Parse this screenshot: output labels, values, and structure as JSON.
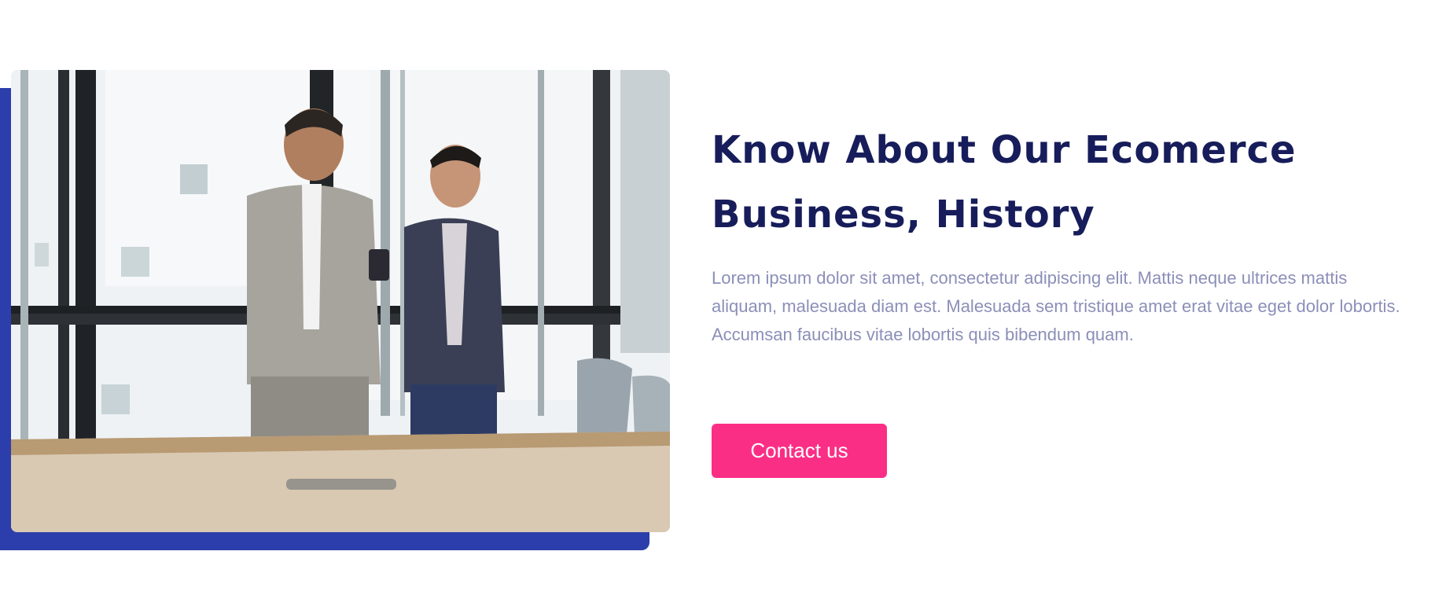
{
  "about": {
    "title": "Know About Our Ecomerce Business, History",
    "description": "Lorem ipsum dolor sit amet, consectetur adipiscing elit. Mattis neque ultrices mattis aliquam, malesuada diam est. Malesuada sem tristique amet erat vitae eget dolor lobortis. Accumsan faucibus vitae lobortis quis bibendum quam.",
    "cta_label": "Contact us"
  },
  "colors": {
    "accent_blue": "#2b3eab",
    "heading": "#171d5a",
    "body_text": "#8b8fb8",
    "button": "#fb2e86"
  },
  "image": {
    "subject": "two-businessmen-looking-at-phone-icon"
  }
}
